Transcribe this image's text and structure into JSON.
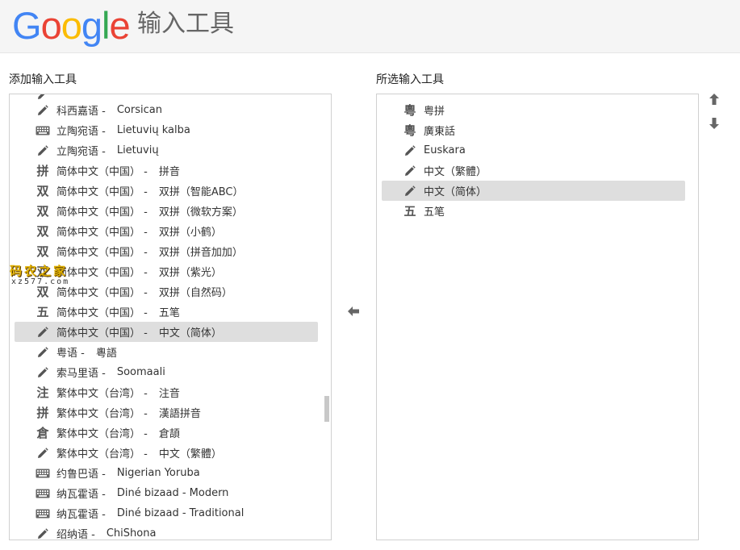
{
  "header": {
    "logo_text": "Google",
    "logo_colors": [
      "#4285F4",
      "#EA4335",
      "#FBBC05",
      "#4285F4",
      "#34A853",
      "#EA4335"
    ],
    "title": "输入工具"
  },
  "left": {
    "label": "添加输入工具",
    "items": [
      {
        "icon": "pencil",
        "name": "科西嘉语 -",
        "method": "Corsican"
      },
      {
        "icon": "keyboard",
        "name": "立陶宛语 -",
        "method": "Lietuvių kalba"
      },
      {
        "icon": "pencil",
        "name": "立陶宛语 -",
        "method": "Lietuvių"
      },
      {
        "icon": "text",
        "icon_text": "拼",
        "name": "简体中文（中国） -",
        "method": "拼音"
      },
      {
        "icon": "text",
        "icon_text": "双",
        "name": "简体中文（中国） -",
        "method": "双拼（智能ABC）"
      },
      {
        "icon": "text",
        "icon_text": "双",
        "name": "简体中文（中国） -",
        "method": "双拼（微软方案）"
      },
      {
        "icon": "text",
        "icon_text": "双",
        "name": "简体中文（中国） -",
        "method": "双拼（小鹤）"
      },
      {
        "icon": "text",
        "icon_text": "双",
        "name": "简体中文（中国） -",
        "method": "双拼（拼音加加）"
      },
      {
        "icon": "text",
        "icon_text": "双",
        "name": "简体中文（中国） -",
        "method": "双拼（紫光）"
      },
      {
        "icon": "text",
        "icon_text": "双",
        "name": "简体中文（中国） -",
        "method": "双拼（自然码）"
      },
      {
        "icon": "text",
        "icon_text": "五",
        "name": "简体中文（中国） -",
        "method": "五笔"
      },
      {
        "icon": "pencil",
        "name": "简体中文（中国） -",
        "method": "中文（简体）",
        "selected": true
      },
      {
        "icon": "pencil",
        "name": "粤语 -",
        "method": "粵語"
      },
      {
        "icon": "pencil",
        "name": "索马里语 -",
        "method": "Soomaali"
      },
      {
        "icon": "text",
        "icon_text": "注",
        "name": "繁体中文（台湾） -",
        "method": "注音"
      },
      {
        "icon": "text",
        "icon_text": "拼",
        "name": "繁体中文（台湾） -",
        "method": "漢語拼音"
      },
      {
        "icon": "text",
        "icon_text": "倉",
        "name": "繁体中文（台湾） -",
        "method": "倉頡"
      },
      {
        "icon": "pencil",
        "name": "繁体中文（台湾） -",
        "method": "中文（繁體）"
      },
      {
        "icon": "keyboard",
        "name": "约鲁巴语 -",
        "method": "Nigerian Yoruba"
      },
      {
        "icon": "keyboard",
        "name": "纳瓦霍语 -",
        "method": "Diné bizaad - Modern"
      },
      {
        "icon": "keyboard",
        "name": "纳瓦霍语 -",
        "method": "Diné bizaad - Traditional"
      },
      {
        "icon": "pencil",
        "name": "绍纳语 -",
        "method": "ChiShona"
      }
    ]
  },
  "right": {
    "label": "所选输入工具",
    "items": [
      {
        "icon": "text",
        "icon_text": "粵",
        "name": "粤拼"
      },
      {
        "icon": "text",
        "icon_text": "粵",
        "name": "廣東話"
      },
      {
        "icon": "pencil",
        "name": "Euskara"
      },
      {
        "icon": "pencil",
        "name": "中文（繁體）"
      },
      {
        "icon": "pencil",
        "name": "中文（简体）",
        "selected": true
      },
      {
        "icon": "text",
        "icon_text": "五",
        "name": "五笔"
      }
    ]
  },
  "watermark": {
    "title": "码农之家",
    "sub": "xz577.com"
  },
  "colors": {
    "selected_bg": "#dedede",
    "border": "#d0d0d0",
    "header_bg": "#f5f5f5"
  }
}
